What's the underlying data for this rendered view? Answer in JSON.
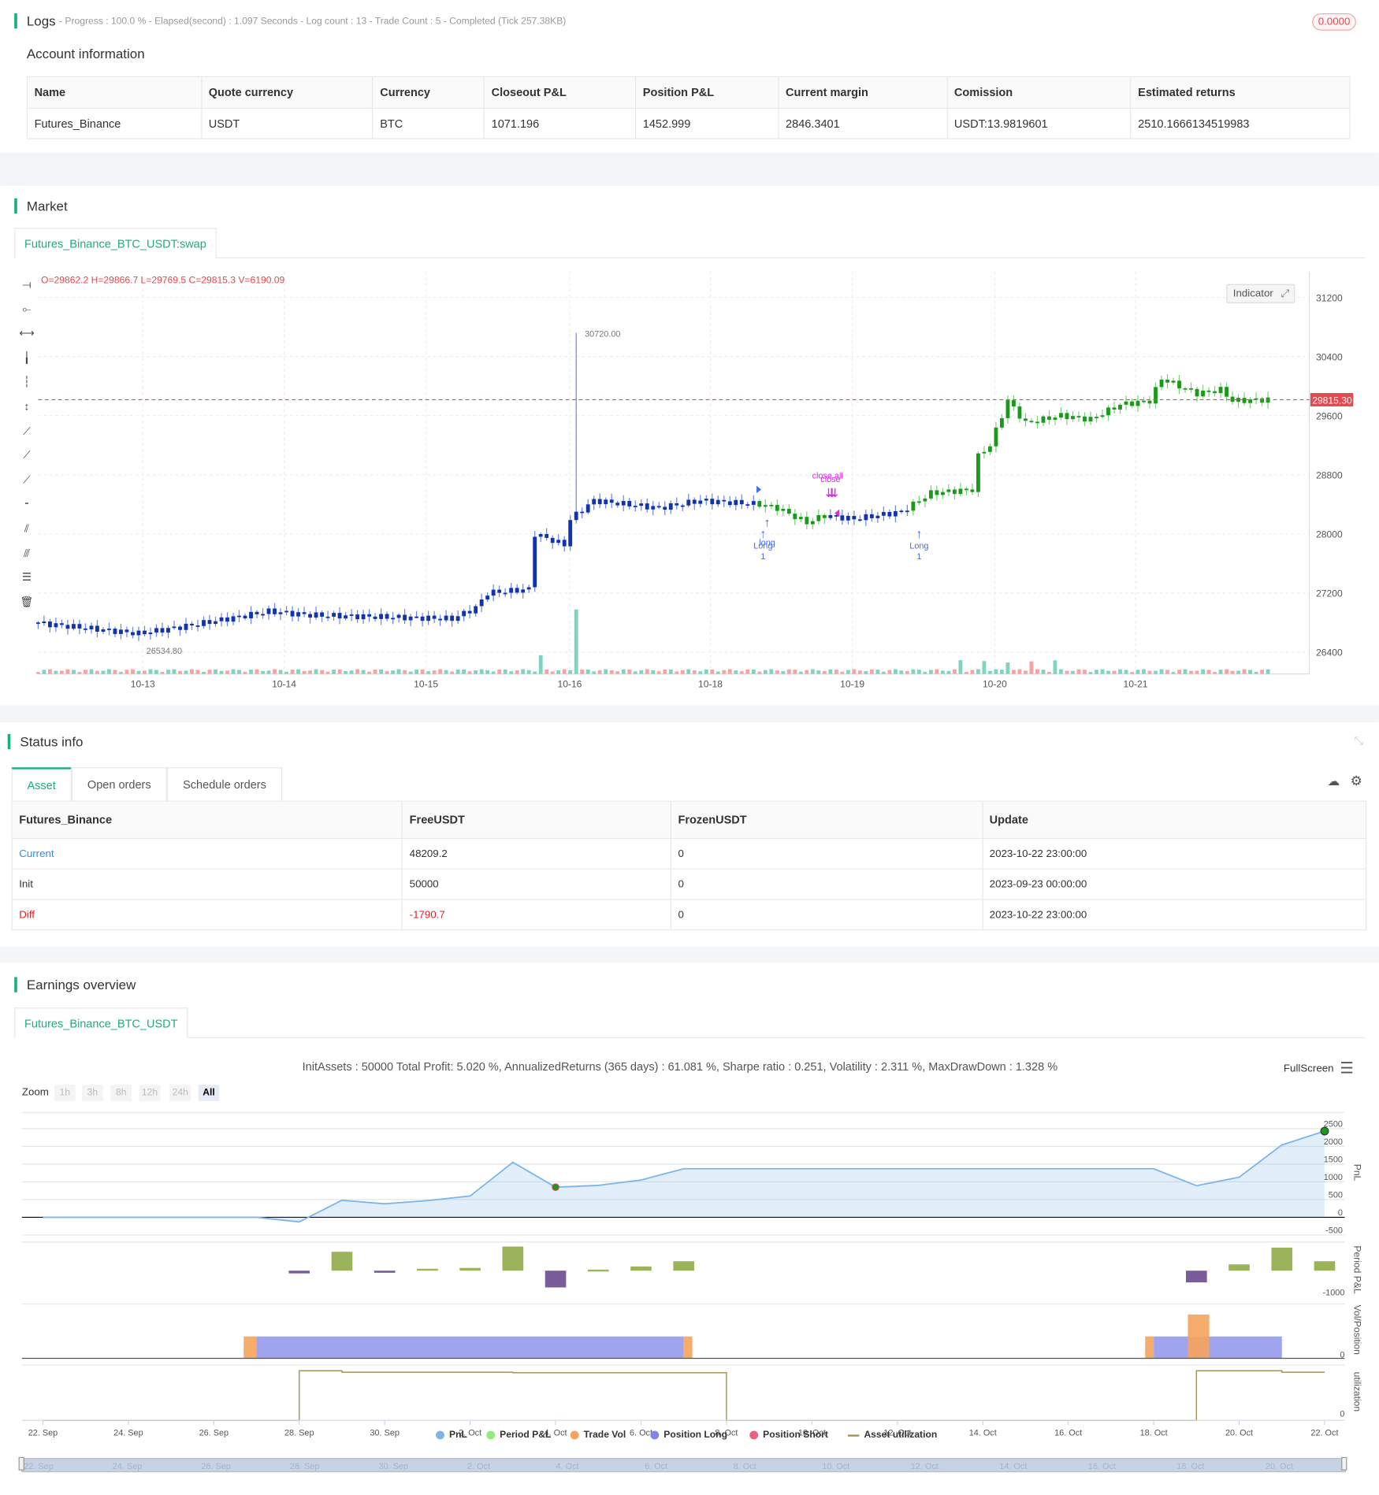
{
  "logs": {
    "title": "Logs",
    "summary": "- Progress : 100.0 % - Elapsed(second) : 1.097  Seconds - Log count : 13 - Trade Count : 5 - Completed (Tick 257.38KB)",
    "badge": "0.0000"
  },
  "account": {
    "title": "Account information",
    "columns": [
      "Name",
      "Quote currency",
      "Currency",
      "Closeout P&L",
      "Position P&L",
      "Current margin",
      "Comission",
      "Estimated returns"
    ],
    "row": [
      "Futures_Binance",
      "USDT",
      "BTC",
      "1071.196",
      "1452.999",
      "2846.3401",
      "USDT:13.9819601",
      "2510.1666134519983"
    ]
  },
  "market": {
    "title": "Market",
    "tab": "Futures_Binance_BTC_USDT:swap",
    "ohlc": "O=29862.2 H=29866.7 L=29769.5 C=29815.3 V=6190.09",
    "indicator": "Indicator",
    "last_price": "29815.30",
    "high_label": "30720.00",
    "low_label": "26534.80",
    "signals": [
      {
        "label": "Long",
        "sub": "1",
        "hour": 122.6,
        "type": "long"
      },
      {
        "label": "long",
        "sub": "",
        "hour": 123.3,
        "type": "long"
      },
      {
        "label": "close all",
        "sub": "",
        "hour": 134,
        "type": "close"
      },
      {
        "label": "close",
        "sub": "",
        "hour": 134.5,
        "type": "close"
      },
      {
        "label": "Long",
        "sub": "1",
        "hour": 149,
        "type": "long"
      }
    ],
    "colors": {
      "up_pos": "#1a9a1a",
      "flat": "#1033b0",
      "last": "#e5484d",
      "signal": "#3d6cf5",
      "close": "#d82ae0"
    }
  },
  "status": {
    "title": "Status info",
    "tabs": [
      "Asset",
      "Open orders",
      "Schedule orders"
    ],
    "columns": [
      "Futures_Binance",
      "FreeUSDT",
      "FrozenUSDT",
      "Update"
    ],
    "rows": [
      [
        "Current",
        "48209.2",
        "0",
        "2023-10-22 23:00:00"
      ],
      [
        "Init",
        "50000",
        "0",
        "2023-09-23 00:00:00"
      ],
      [
        "Diff",
        "-1790.7",
        "0",
        "2023-10-22 23:00:00"
      ]
    ]
  },
  "earnings": {
    "title": "Earnings overview",
    "tab": "Futures_Binance_BTC_USDT",
    "stats": "InitAssets : 50000 Total Profit: 5.020 %, AnnualizedReturns (365 days) : 61.081 %, Sharpe ratio : 0.251, Volatility : 2.311 %, MaxDrawDown : 1.328 %",
    "fullscreen": "FullScreen",
    "zoom_label": "Zoom",
    "zoom_buttons": [
      "1h",
      "3h",
      "8h",
      "12h",
      "24h",
      "All"
    ],
    "legend": [
      {
        "label": "PnL",
        "color": "#7cb5ec"
      },
      {
        "label": "Period P&L",
        "color": "#90ed7d"
      },
      {
        "label": "Trade Vol",
        "color": "#f7a35c"
      },
      {
        "label": "Position Long",
        "color": "#8085e9"
      },
      {
        "label": "Position Short",
        "color": "#f15c80"
      },
      {
        "label": "Asset utilization",
        "color": "#a0955c"
      }
    ],
    "axis_titles": [
      "PnL",
      "Period P&L",
      "Vol/Position",
      "utilization"
    ]
  },
  "chart_data": [
    {
      "type": "candlestick",
      "title": "Futures_Binance_BTC_USDT:swap",
      "y_ticks": [
        31200,
        30400,
        29600,
        28800,
        28000,
        27200,
        26400
      ],
      "ylim": [
        26100,
        31400
      ],
      "x_ticks": [
        {
          "label": "10-13",
          "hour": 17.7
        },
        {
          "label": "10-14",
          "hour": 41.6
        },
        {
          "label": "10-15",
          "hour": 65.6
        },
        {
          "label": "10-16",
          "hour": 89.9
        },
        {
          "label": "10-18",
          "hour": 113.7
        },
        {
          "label": "10-19",
          "hour": 137.7
        },
        {
          "label": "10-20",
          "hour": 161.8
        },
        {
          "label": "10-21",
          "hour": 185.6
        }
      ],
      "price_path": [
        [
          0,
          26800
        ],
        [
          18,
          26650
        ],
        [
          26,
          26750
        ],
        [
          40,
          26950
        ],
        [
          47,
          26900
        ],
        [
          71,
          26850
        ],
        [
          75,
          27000
        ],
        [
          77,
          27200
        ],
        [
          84,
          27250
        ],
        [
          85,
          28000
        ],
        [
          90,
          27850
        ],
        [
          91,
          28200
        ],
        [
          95,
          28450
        ],
        [
          106,
          28350
        ],
        [
          113,
          28450
        ],
        [
          123,
          28400
        ],
        [
          126,
          28350
        ],
        [
          131,
          28150
        ],
        [
          134,
          28250
        ],
        [
          139,
          28200
        ],
        [
          147,
          28300
        ],
        [
          152,
          28550
        ],
        [
          159,
          28600
        ],
        [
          160,
          29050
        ],
        [
          162,
          29200
        ],
        [
          165,
          29800
        ],
        [
          168,
          29500
        ],
        [
          174,
          29600
        ],
        [
          179,
          29550
        ],
        [
          184,
          29750
        ],
        [
          189,
          29800
        ],
        [
          191,
          30100
        ],
        [
          197,
          29900
        ],
        [
          201,
          29950
        ],
        [
          203,
          29800
        ],
        [
          208,
          29815
        ]
      ],
      "spike": {
        "hour": 91,
        "high": 30720
      },
      "low_point": {
        "hour": 17,
        "low": 26534.8
      },
      "position_periods": [
        [
          122,
          134
        ],
        [
          148,
          209
        ]
      ]
    },
    {
      "type": "line",
      "series": [
        {
          "name": "PnL",
          "x_days": [
            0,
            1,
            2,
            3,
            4,
            5,
            6,
            7,
            8,
            9,
            10,
            11,
            12,
            13,
            14,
            15,
            16,
            17,
            18,
            19,
            20,
            21,
            22,
            23,
            24,
            25,
            26,
            27,
            28,
            29,
            30
          ],
          "values": [
            0,
            0,
            0,
            0,
            0,
            0,
            -130,
            480,
            380,
            470,
            600,
            1550,
            850,
            900,
            1050,
            1370,
            1370,
            1370,
            1370,
            1370,
            1370,
            1370,
            1370,
            1370,
            1370,
            1370,
            1370,
            890,
            1130,
            2040,
            2430
          ]
        },
        {
          "name": "Period P&L",
          "x_days": [
            6,
            7,
            8,
            9,
            10,
            11,
            12,
            13,
            14,
            15,
            27,
            28,
            29,
            30
          ],
          "values": [
            -130,
            900,
            -100,
            90,
            130,
            1150,
            -800,
            50,
            200,
            450,
            -560,
            300,
            1100,
            450
          ]
        },
        {
          "name": "Trade Vol",
          "ranges": [
            [
              4.7,
              5
            ],
            [
              15,
              15.2
            ],
            [
              25.8,
              26
            ],
            [
              26.8,
              27.3
            ]
          ],
          "values": [
            1,
            1,
            1,
            2
          ]
        },
        {
          "name": "Position Long",
          "ranges": [
            [
              5,
              15
            ],
            [
              26,
              29
            ]
          ],
          "values": [
            1,
            1
          ]
        },
        {
          "name": "Asset utilization",
          "steps": [
            [
              0,
              0
            ],
            [
              6,
              1
            ],
            [
              7,
              0.97
            ],
            [
              11,
              0.96
            ],
            [
              16,
              0
            ],
            [
              27,
              1
            ],
            [
              29,
              0.97
            ],
            [
              30,
              0.97
            ]
          ]
        }
      ],
      "x_ticks": [
        "22. Sep",
        "24. Sep",
        "26. Sep",
        "28. Sep",
        "30. Sep",
        "2. Oct",
        "4. Oct",
        "6. Oct",
        "8. Oct",
        "10. Oct",
        "12. Oct",
        "14. Oct",
        "16. Oct",
        "18. Oct",
        "20. Oct",
        "22. Oct"
      ],
      "pnl_y_ticks": [
        2500,
        2000,
        1500,
        1000,
        500,
        0,
        -500
      ],
      "period_y_ticks": [
        -1000
      ],
      "vol_y_ticks": [
        0
      ],
      "util_y_ticks": [
        0
      ]
    }
  ]
}
